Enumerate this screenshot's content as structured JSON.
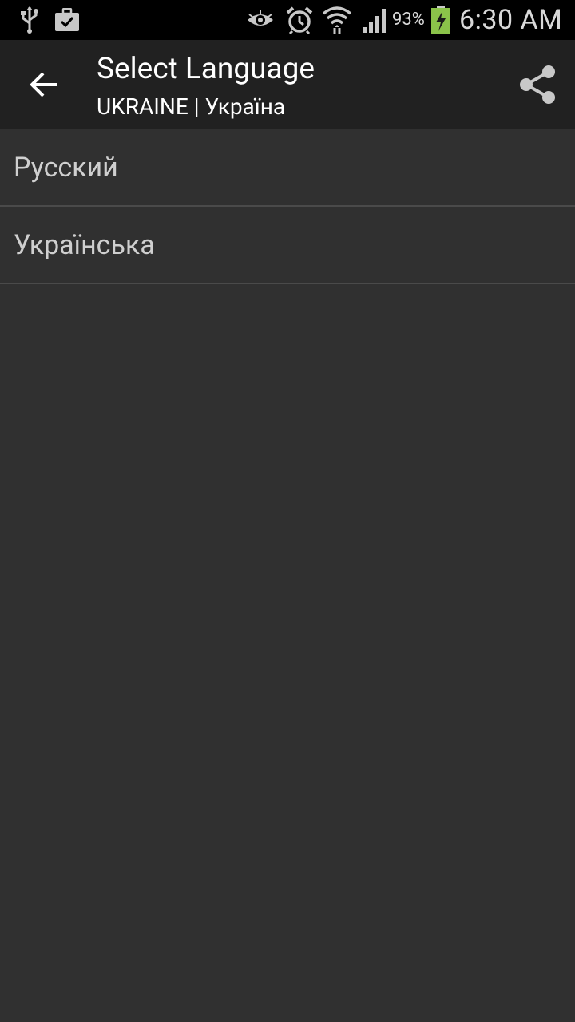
{
  "status_bar": {
    "icons": [
      "usb-icon",
      "briefcase-check-icon",
      "eye-icon",
      "alarm-icon",
      "wifi-icon",
      "signal-icon",
      "battery-charging-icon"
    ],
    "battery_percent": "93%",
    "time": "6:30 AM"
  },
  "app_bar": {
    "title": "Select Language",
    "subtitle": "UKRAINE | Україна",
    "back_icon": "arrow-left-icon",
    "share_icon": "share-icon"
  },
  "languages": [
    {
      "label": "Русский"
    },
    {
      "label": "Українська"
    }
  ],
  "colors": {
    "background": "#303030",
    "app_bar": "#212121",
    "status_bar": "#000000",
    "battery_accent": "#8bc34a"
  }
}
